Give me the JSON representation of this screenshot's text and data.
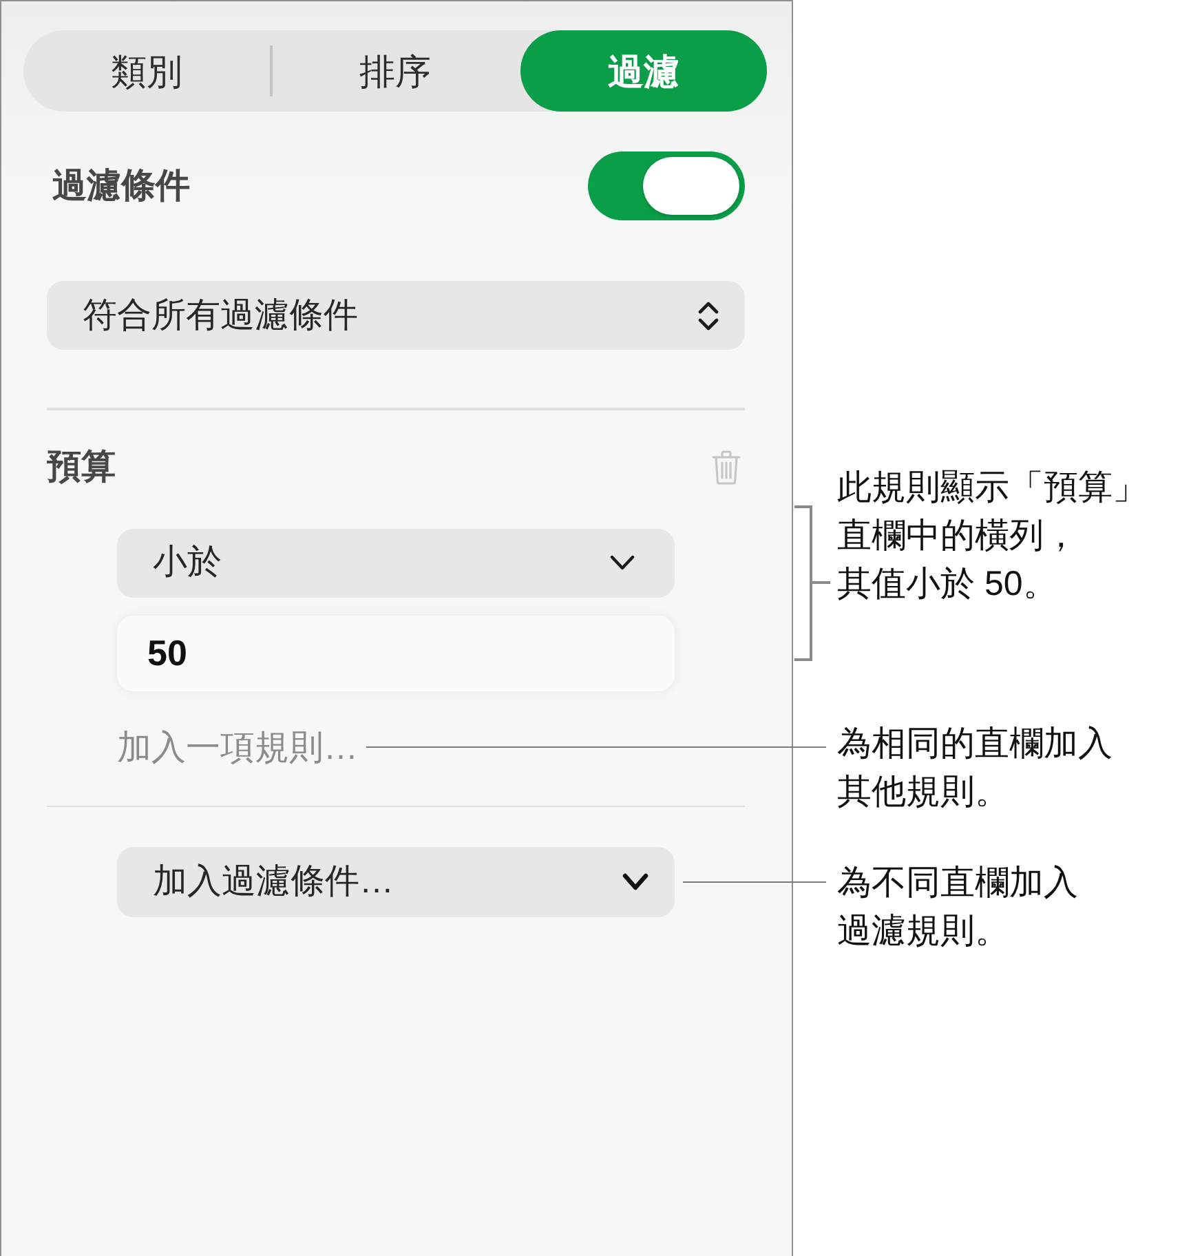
{
  "tabs": [
    {
      "label": "類別",
      "selected": false
    },
    {
      "label": "排序",
      "selected": false
    },
    {
      "label": "過濾",
      "selected": true
    }
  ],
  "filters": {
    "label": "過濾條件",
    "on": true,
    "match": "符合所有過濾條件"
  },
  "rules": [
    {
      "column": "預算",
      "conditions": [
        {
          "operator": "小於",
          "value": "50"
        }
      ],
      "add_rule": "加入一項規則…"
    }
  ],
  "add_filter": "加入過濾條件…",
  "callouts": [
    {
      "kind": "bracket",
      "text": "此規則顯示「預算」直欄中的橫列，其值小於 50。"
    },
    {
      "kind": "leader",
      "text": "為相同的直欄加入其他規則。"
    },
    {
      "kind": "leader",
      "text": "為不同直欄加入過濾規則。"
    }
  ]
}
